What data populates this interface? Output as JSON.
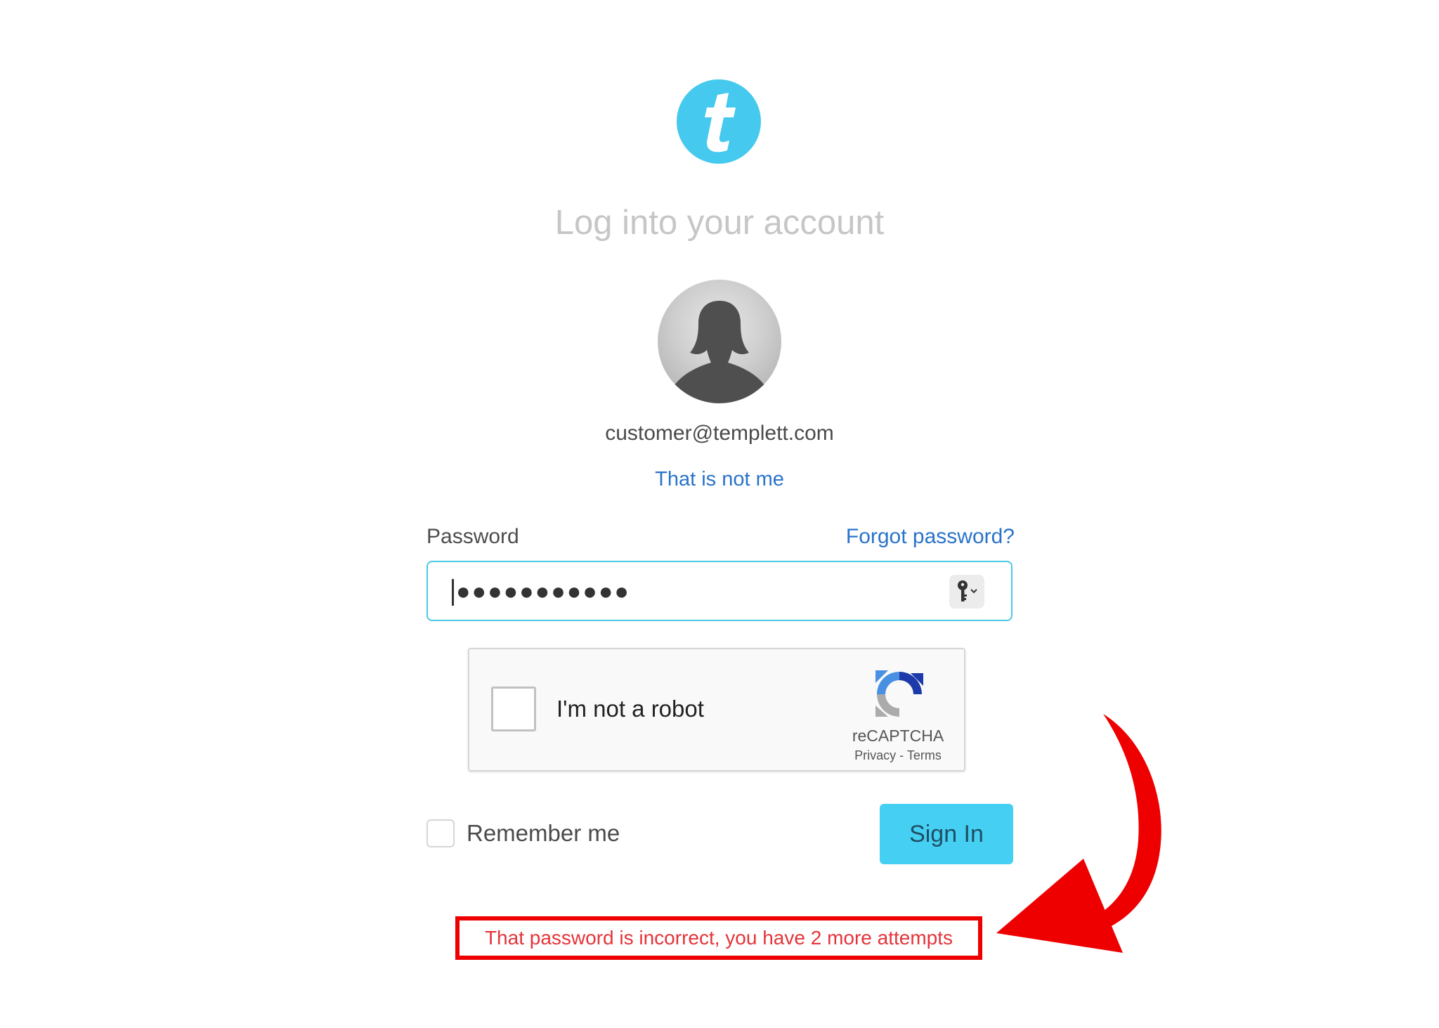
{
  "brand": {
    "logo_letter": "t",
    "logo_color": "#45c9ee"
  },
  "heading": "Log into your account",
  "account": {
    "email": "customer@templett.com",
    "not_me_link": "That is not me"
  },
  "password": {
    "label": "Password",
    "forgot_link": "Forgot password?",
    "masked_value": "●●●●●●●●●●●",
    "key_icon": "key-icon"
  },
  "recaptcha": {
    "label": "I'm not a robot",
    "brand": "reCAPTCHA",
    "links": "Privacy - Terms",
    "checked": false
  },
  "remember": {
    "label": "Remember me",
    "checked": false
  },
  "sign_in_label": "Sign In",
  "error": {
    "message": "That password is incorrect, you have 2 more attempts",
    "color": "#e4343a"
  },
  "annotation": {
    "arrow_color": "#ee0000"
  }
}
